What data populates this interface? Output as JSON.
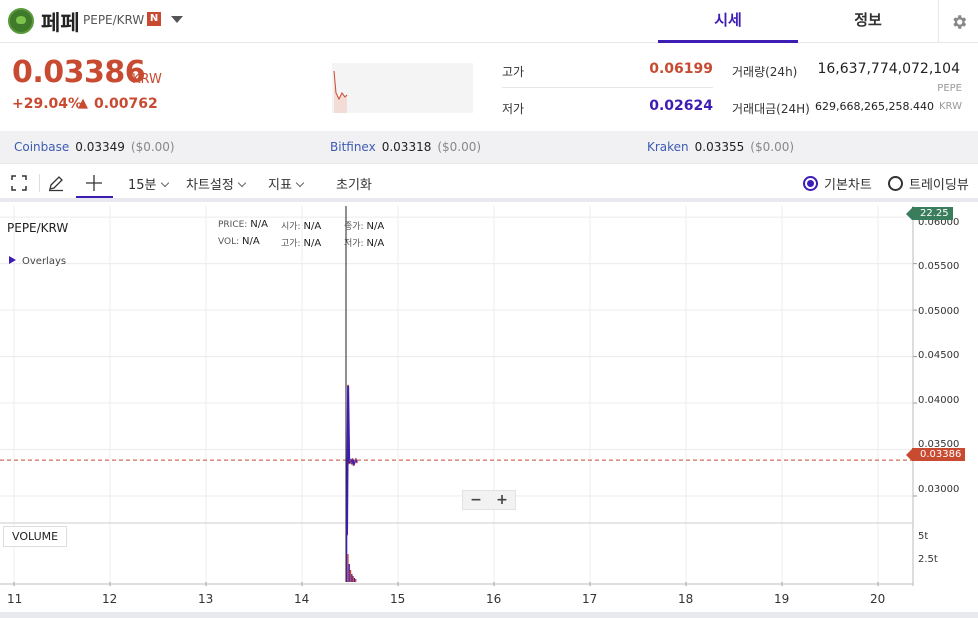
{
  "header": {
    "coin_name": "페페",
    "pair": "PEPE/KRW",
    "new_badge": "N",
    "tabs": [
      "시세",
      "정보"
    ]
  },
  "price": {
    "current": "0.03386",
    "unit": "KRW",
    "change_pct": "+29.04%",
    "change_arrow": "▲",
    "change_value": "0.00762"
  },
  "stats": {
    "high_label": "고가",
    "high_value": "0.06199",
    "low_label": "저가",
    "low_value": "0.02624",
    "volume_label": "거래량(24h)",
    "volume_value": "16,637,774,072,104",
    "volume_unit": "PEPE",
    "amount_label": "거래대금(24H)",
    "amount_value": "629,668,265,258.440",
    "amount_unit": "KRW"
  },
  "exchanges": [
    {
      "name": "Coinbase",
      "price": "0.03349",
      "usd": "($0.00)"
    },
    {
      "name": "Bitfinex",
      "price": "0.03318",
      "usd": "($0.00)"
    },
    {
      "name": "Kraken",
      "price": "0.03355",
      "usd": "($0.00)"
    }
  ],
  "toolbar": {
    "interval": "15분",
    "chart_settings": "차트설정",
    "indicators": "지표",
    "reset": "초기화",
    "view_basic": "기본차트",
    "view_trading": "트레이딩뷰",
    "selected_view": "기본차트"
  },
  "chart": {
    "pair_label": "PEPE/KRW",
    "overlays_label": "Overlays",
    "info": {
      "price_label": "PRICE:",
      "price": "N/A",
      "open_label": "시가:",
      "open": "N/A",
      "close_label": "종가:",
      "close": "N/A",
      "vol_label": "VOL:",
      "vol": "N/A",
      "high_label": "고가:",
      "high": "N/A",
      "low_label": "저가:",
      "low": "N/A"
    },
    "zoom_out": "−",
    "zoom_in": "+",
    "volume_label": "VOLUME",
    "green_tag": "22.25",
    "price_tag": "0.03386",
    "volume_ticks": [
      "5t",
      "2.5t"
    ]
  },
  "chart_data": {
    "type": "line",
    "y_ticks": [
      "0.06000",
      "0.05500",
      "0.05000",
      "0.04500",
      "0.04000",
      "0.03500",
      "0.03000"
    ],
    "x_ticks": [
      "11",
      "12",
      "13",
      "14",
      "15",
      "16",
      "17",
      "18",
      "19",
      "20"
    ],
    "current_price": 0.03386,
    "ylim": [
      0.0272,
      0.0612
    ],
    "series": [
      {
        "values": [
          0.0258,
          0.0419,
          0.0335,
          0.0338,
          0.0336,
          0.034,
          0.0333,
          0.0337,
          0.0339,
          0.0336
        ]
      }
    ],
    "grid": true
  },
  "colors": {
    "accent": "#3e1db5",
    "rise": "#c84a31",
    "fall": "#3e1db5",
    "tag_green": "#3a7d5c"
  }
}
